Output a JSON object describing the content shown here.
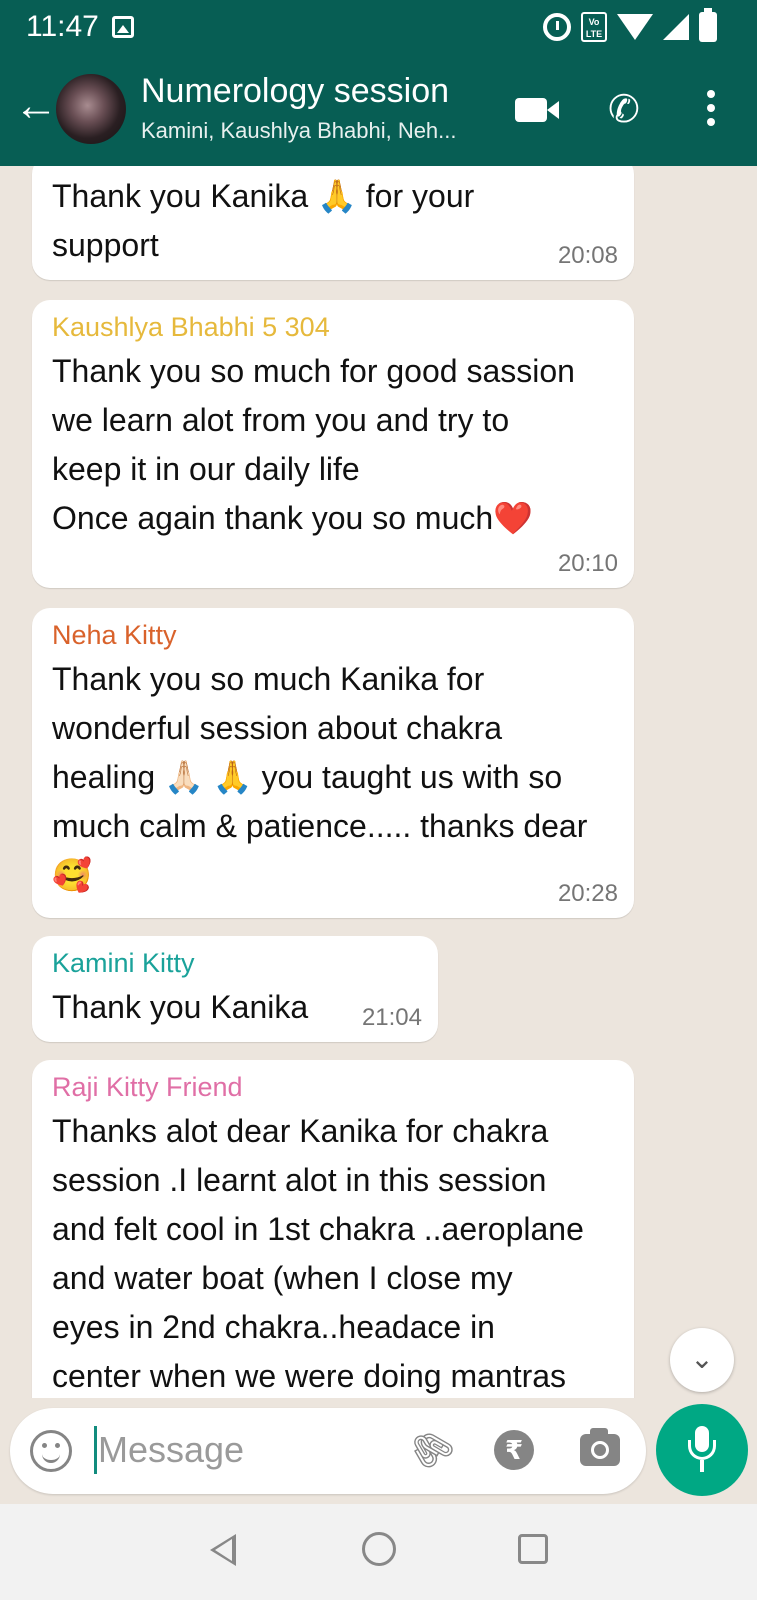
{
  "status_bar": {
    "time": "11:47",
    "volte_label": "Vo LTE"
  },
  "header": {
    "back_glyph": "←",
    "title": "Numerology session",
    "subtitle": "Kamini, Kaushlya Bhabhi, Neh..."
  },
  "messages": [
    {
      "sender": "",
      "sender_color": "",
      "text": "Thank you Kanika 🙏 for your\nsupport",
      "time": "20:08"
    },
    {
      "sender": "Kaushlya Bhabhi 5 304",
      "sender_color": "#e6b93c",
      "text": "Thank you so much for good sassion\nwe learn alot from you and try to\nkeep it in our daily life\nOnce again thank you so much❤️",
      "time": "20:10"
    },
    {
      "sender": "Neha Kitty",
      "sender_color": "#d9622b",
      "text": "Thank you so much Kanika for\nwonderful session about chakra\nhealing 🙏🏻 🙏 you taught us with so\nmuch calm & patience..... thanks dear\n🥰",
      "time": "20:28"
    },
    {
      "sender": "Kamini Kitty",
      "sender_color": "#1aa29a",
      "text": "Thank you Kanika",
      "time": "21:04"
    },
    {
      "sender": "Raji Kitty Friend",
      "sender_color": "#e06fa6",
      "text": "Thanks alot dear Kanika for chakra\nsession .I learnt alot in this session\nand felt cool in 1st chakra ..aeroplane\nand water boat (when I close my\neyes in 2nd chakra..headace in\ncenter when we were doing mantras",
      "time": ""
    }
  ],
  "input": {
    "placeholder": "Message",
    "rupee_glyph": "₹",
    "clip_glyph": "🖇",
    "scroll_glyph": "⌄"
  },
  "colors": {
    "header": "#075e54",
    "accent": "#00a884",
    "chat_bg": "#ece5dd"
  }
}
